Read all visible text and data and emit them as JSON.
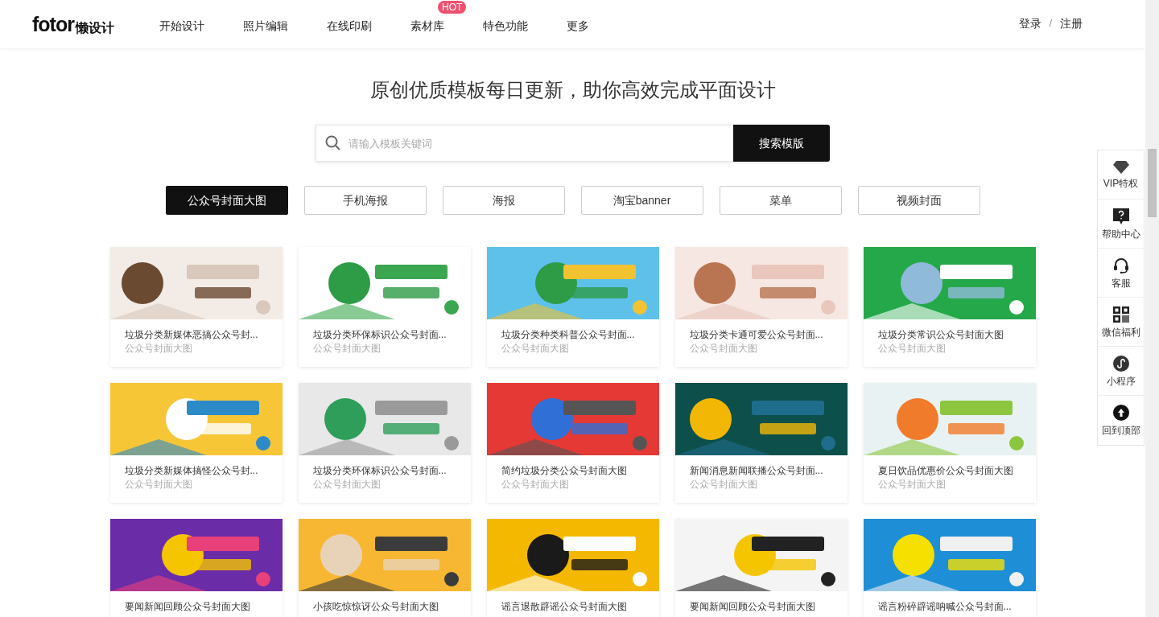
{
  "header": {
    "logo": {
      "wordmark": "fotor",
      "suffix": "懒设计"
    },
    "nav": [
      {
        "label": "开始设计"
      },
      {
        "label": "照片编辑"
      },
      {
        "label": "在线印刷"
      },
      {
        "label": "素材库",
        "badge": "HOT"
      },
      {
        "label": "特色功能"
      },
      {
        "label": "更多"
      }
    ],
    "account": {
      "login": "登录",
      "separator": "/",
      "register": "注册"
    }
  },
  "headline": "原创优质模板每日更新，助你高效完成平面设计",
  "search": {
    "placeholder": "请输入模板关键词",
    "button": "搜索模版"
  },
  "categories": [
    {
      "label": "公众号封面大图",
      "selected": true
    },
    {
      "label": "手机海报",
      "selected": false
    },
    {
      "label": "海报",
      "selected": false
    },
    {
      "label": "淘宝banner",
      "selected": false
    },
    {
      "label": "菜单",
      "selected": false
    },
    {
      "label": "视频封面",
      "selected": false
    }
  ],
  "templates": [
    {
      "title": "垃圾分类新媒体恶搞公众号封...",
      "subtitle": "公众号封面大图"
    },
    {
      "title": "垃圾分类环保标识公众号封面...",
      "subtitle": "公众号封面大图"
    },
    {
      "title": "垃圾分类种类科普公众号封面...",
      "subtitle": "公众号封面大图"
    },
    {
      "title": "垃圾分类卡通可爱公众号封面...",
      "subtitle": "公众号封面大图"
    },
    {
      "title": "垃圾分类常识公众号封面大图",
      "subtitle": "公众号封面大图"
    },
    {
      "title": "垃圾分类新媒体搞怪公众号封...",
      "subtitle": "公众号封面大图"
    },
    {
      "title": "垃圾分类环保标识公众号封面...",
      "subtitle": "公众号封面大图"
    },
    {
      "title": "简约垃圾分类公众号封面大图",
      "subtitle": "公众号封面大图"
    },
    {
      "title": "新闻消息新闻联播公众号封面...",
      "subtitle": "公众号封面大图"
    },
    {
      "title": "夏日饮品优惠价公众号封面大图",
      "subtitle": "公众号封面大图"
    },
    {
      "title": "要闻新闻回顾公众号封面大图"
    },
    {
      "title": "小孩吃惊惊讶公众号封面大图"
    },
    {
      "title": "谣言退散辟谣公众号封面大图"
    },
    {
      "title": "要闻新闻回顾公众号封面大图"
    },
    {
      "title": "谣言粉碎辟谣呐喊公众号封面..."
    }
  ],
  "side_tools": [
    {
      "label": "VIP特权",
      "kind": "diamond"
    },
    {
      "label": "帮助中心",
      "kind": "help"
    },
    {
      "label": "客服",
      "kind": "headset"
    },
    {
      "label": "微信福利",
      "kind": "qr"
    },
    {
      "label": "小程序",
      "kind": "link"
    },
    {
      "label": "回到顶部",
      "kind": "top"
    }
  ]
}
